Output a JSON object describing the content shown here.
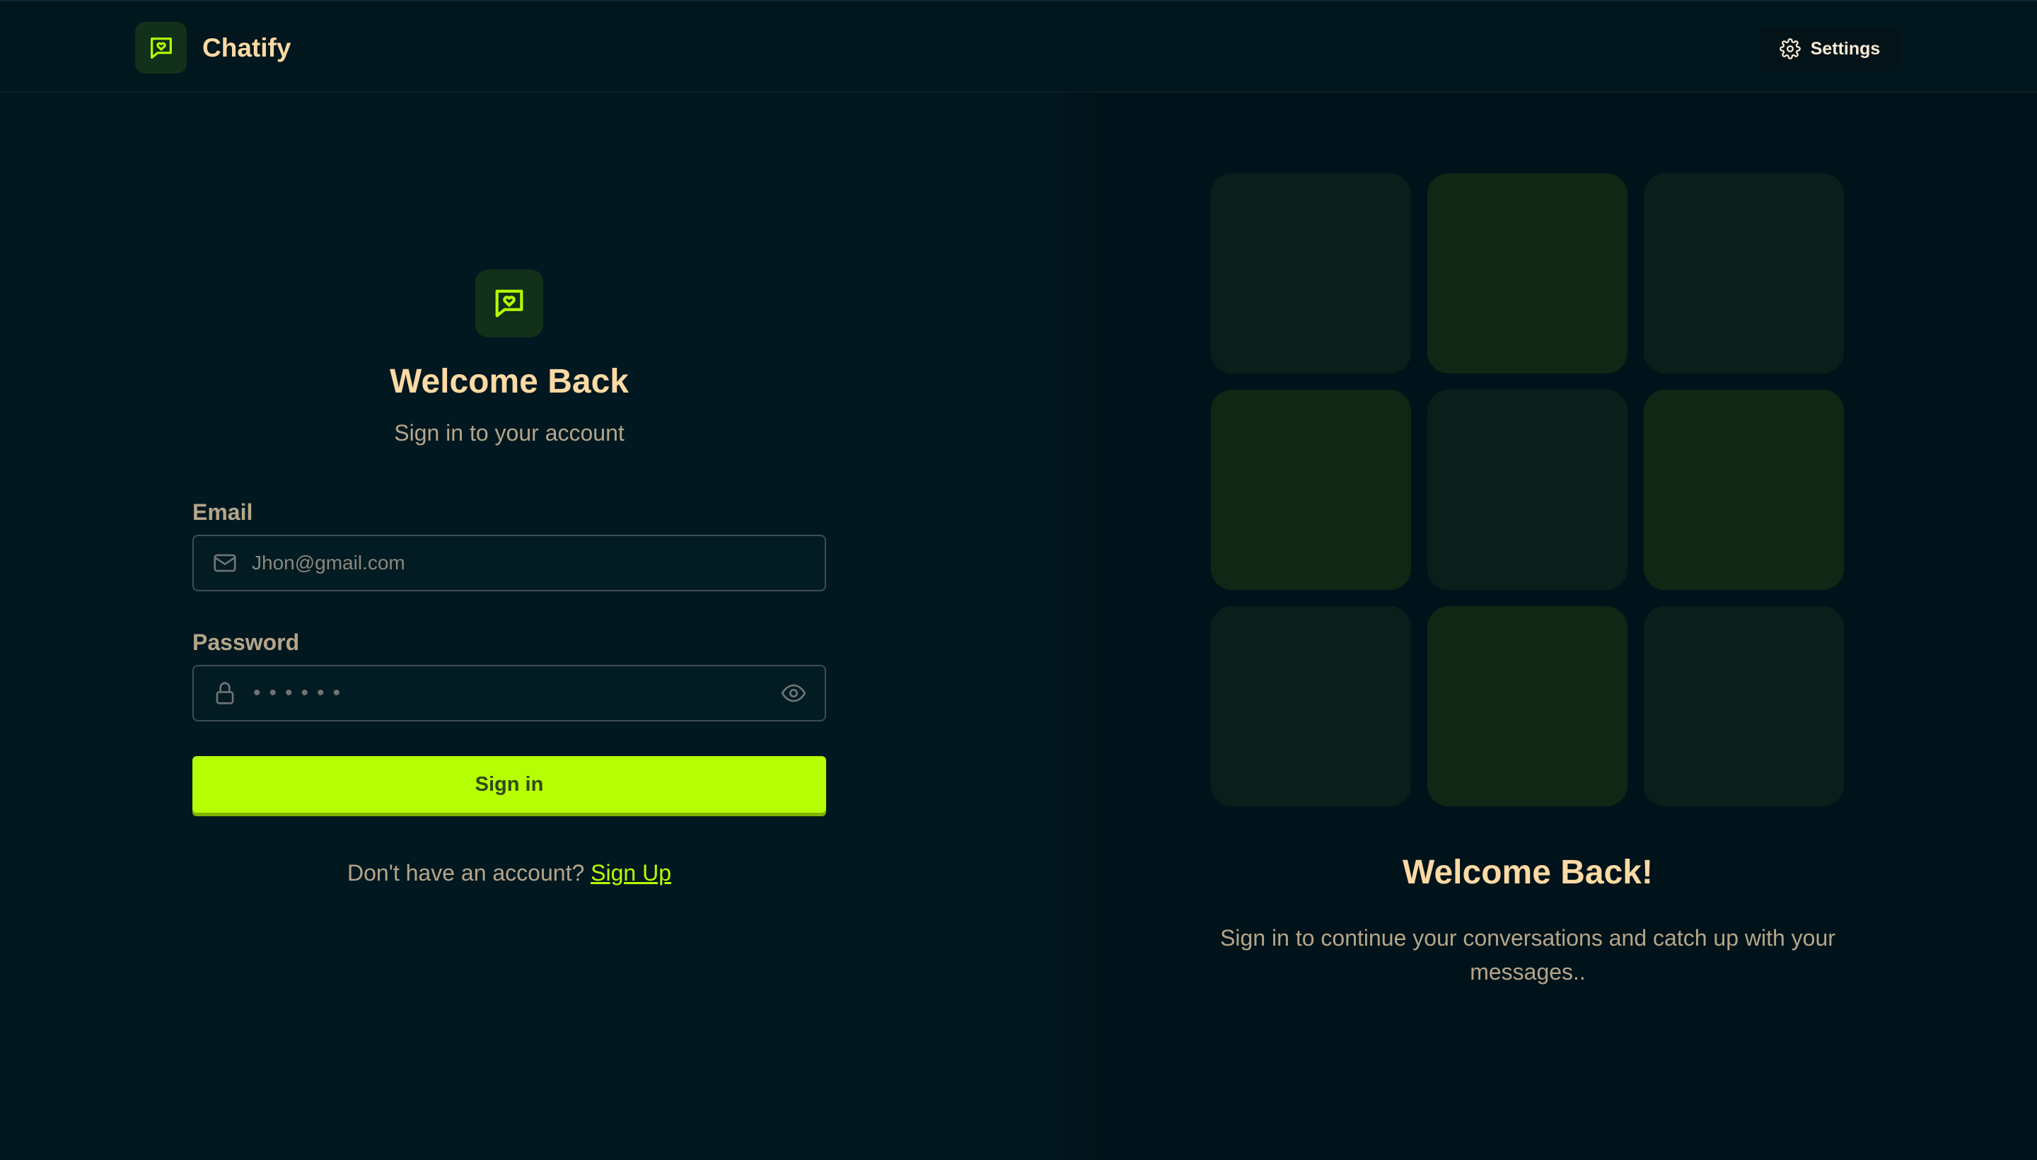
{
  "header": {
    "app_name": "Chatify",
    "settings_label": "Settings",
    "logo_icon": "message-heart-icon",
    "settings_icon": "gear-icon"
  },
  "login_form": {
    "title": "Welcome Back",
    "subtitle": "Sign in to your account",
    "email_label": "Email",
    "email_placeholder": "Jhon@gmail.com",
    "email_icon": "mail-icon",
    "password_label": "Password",
    "password_mask": "••••••",
    "password_icon": "lock-icon",
    "show_password_icon": "eye-icon",
    "submit_label": "Sign in",
    "signup_prompt": "Don't have an account?",
    "signup_link": "Sign Up"
  },
  "promo": {
    "title": "Welcome Back!",
    "text": "Sign in to continue your conversations and catch up with your messages.."
  },
  "colors": {
    "accent": "#b6fe04",
    "heading": "#fdd9a4",
    "muted_text": "#b4a589",
    "background": "#021820"
  }
}
